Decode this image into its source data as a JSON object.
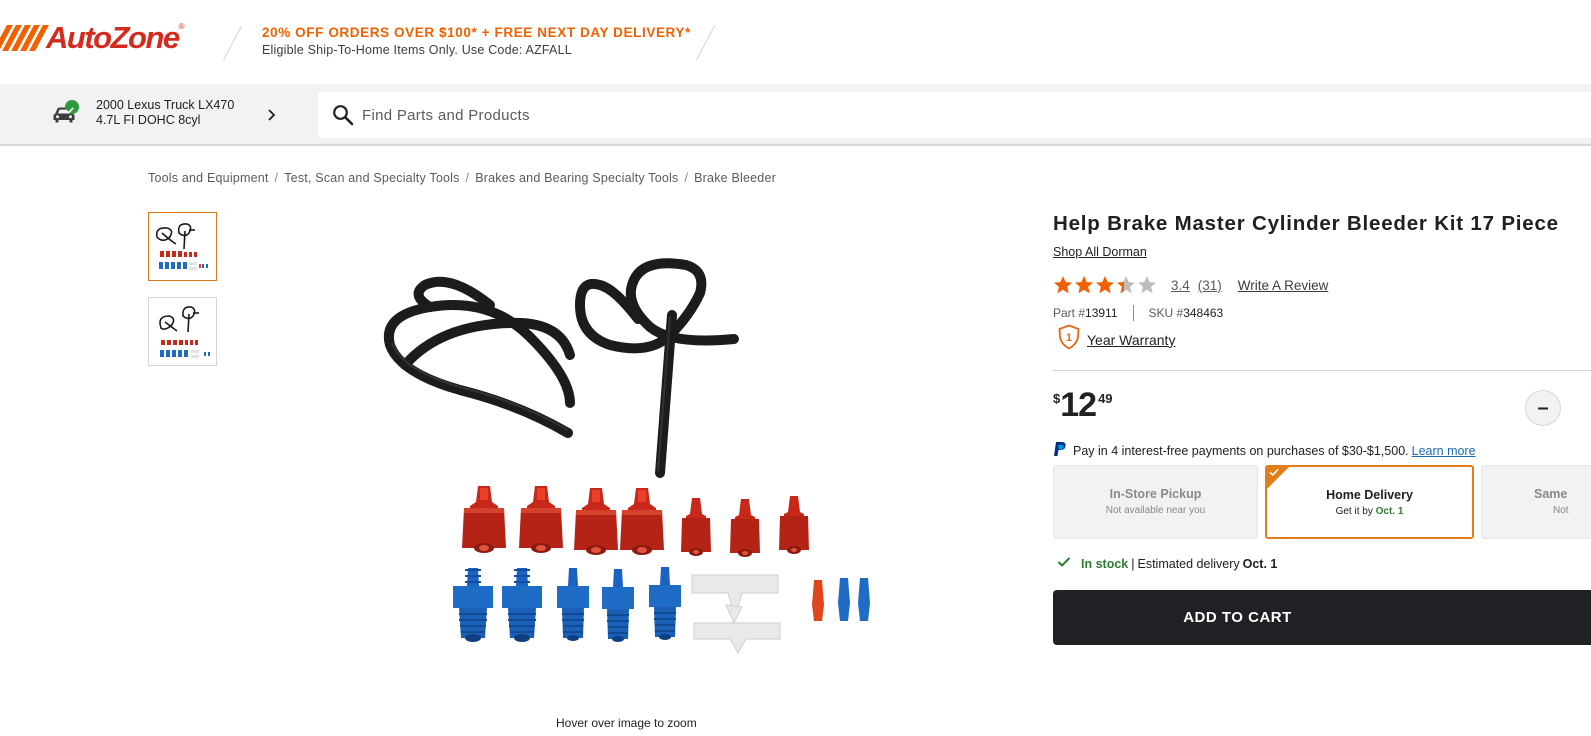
{
  "header": {
    "logo_text": "AutoZone",
    "logo_mark": "®",
    "promo_title": "20% OFF ORDERS OVER $100* + FREE NEXT DAY DELIVERY*",
    "promo_subtitle": "Eligible Ship-To-Home Items Only. Use Code: AZFALL"
  },
  "vehicle": {
    "line1": "2000 Lexus Truck LX470",
    "line2": "4.7L FI DOHC 8cyl",
    "icon": "car-icon"
  },
  "search": {
    "placeholder": "Find Parts and Products",
    "icon": "search-icon"
  },
  "breadcrumb": {
    "items": [
      "Tools and Equipment",
      "Test, Scan and Specialty Tools",
      "Brakes and Bearing Specialty Tools",
      "Brake Bleeder"
    ],
    "separator": "/"
  },
  "gallery": {
    "thumbnail_count": 2,
    "active_index": 0,
    "zoom_hint": "Hover over image to zoom"
  },
  "product": {
    "title": "Help Brake Master Cylinder Bleeder Kit 17 Piece",
    "brand_link": "Shop All Dorman",
    "rating": {
      "value": 3.4,
      "value_text": "3.4",
      "count_text": "(31)",
      "max": 5,
      "write_review": "Write A Review"
    },
    "part_label": "Part #",
    "part_number": "13911",
    "sku_label": "SKU #",
    "sku_number": "348463",
    "warranty_badge": "1",
    "warranty_text": "Year Warranty",
    "price": {
      "currency": "$",
      "whole": "12",
      "cents": "49"
    },
    "qty_minus": "–",
    "paypal": {
      "text": "Pay in 4 interest-free payments on purchases of $30-$1,500.",
      "link": "Learn more"
    },
    "delivery_options": [
      {
        "title": "In-Store Pickup",
        "subtitle": "Not available near you",
        "state": "disabled"
      },
      {
        "title": "Home Delivery",
        "subtitle_prefix": "Get it by",
        "subtitle_date": "Oct. 1",
        "state": "selected"
      },
      {
        "title": "Same",
        "subtitle": "Not",
        "state": "disabled"
      }
    ],
    "stock": {
      "status": "In stock",
      "separator": "|",
      "estimate_label": "Estimated delivery",
      "estimate_date": "Oct. 1"
    },
    "add_to_cart": "ADD TO CART"
  },
  "colors": {
    "brand_orange": "#f26100",
    "brand_red": "#d52b1e",
    "selected_border": "#e07e1c",
    "stock_green": "#2e7d32",
    "star_orange": "#f26100",
    "link_blue": "#1b6ab5",
    "cta_dark": "#202124"
  }
}
